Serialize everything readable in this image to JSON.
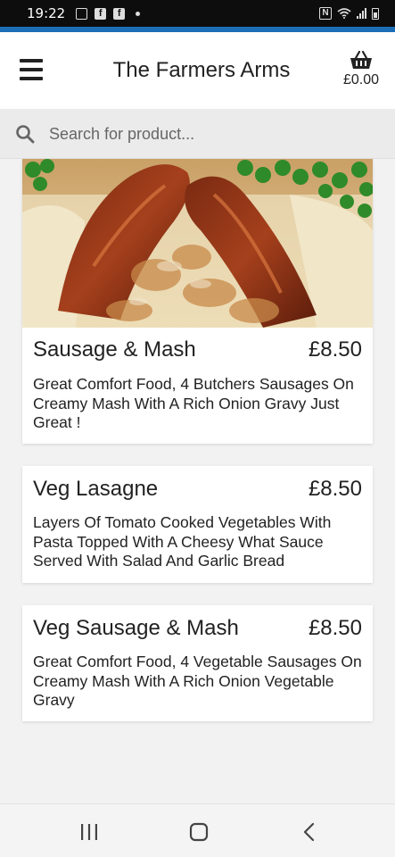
{
  "status_bar": {
    "time": "19:22",
    "left_icons": [
      "gallery-icon",
      "facebook-icon",
      "facebook-icon",
      "dot-icon"
    ],
    "right_icons": [
      "nfc-icon",
      "wifi-icon",
      "signal-icon",
      "battery-icon"
    ]
  },
  "accent_color": "#1c6fb7",
  "header": {
    "title": "The Farmers Arms",
    "basket_total": "£0.00",
    "menu_icon": "hamburger-menu-icon",
    "basket_icon": "basket-icon"
  },
  "search": {
    "placeholder": "Search for product...",
    "value": "",
    "icon": "search-icon"
  },
  "menu_items": [
    {
      "name": "Sausage & Mash",
      "price": "£8.50",
      "description": "Great Comfort Food, 4 Butchers Sausages On Creamy Mash With A Rich Onion Gravy Just Great !",
      "has_image": true
    },
    {
      "name": "Veg Lasagne",
      "price": "£8.50",
      "description": "Layers Of Tomato Cooked Vegetables With Pasta Topped With A Cheesy What Sauce Served With Salad And Garlic Bread"
    },
    {
      "name": "Veg Sausage & Mash",
      "price": "£8.50",
      "description": "Great Comfort Food, 4 Vegetable Sausages On Creamy Mash With A Rich Onion Vegetable Gravy"
    }
  ],
  "nav_bar": {
    "buttons": [
      "recent-apps-icon",
      "home-icon",
      "back-icon"
    ]
  }
}
